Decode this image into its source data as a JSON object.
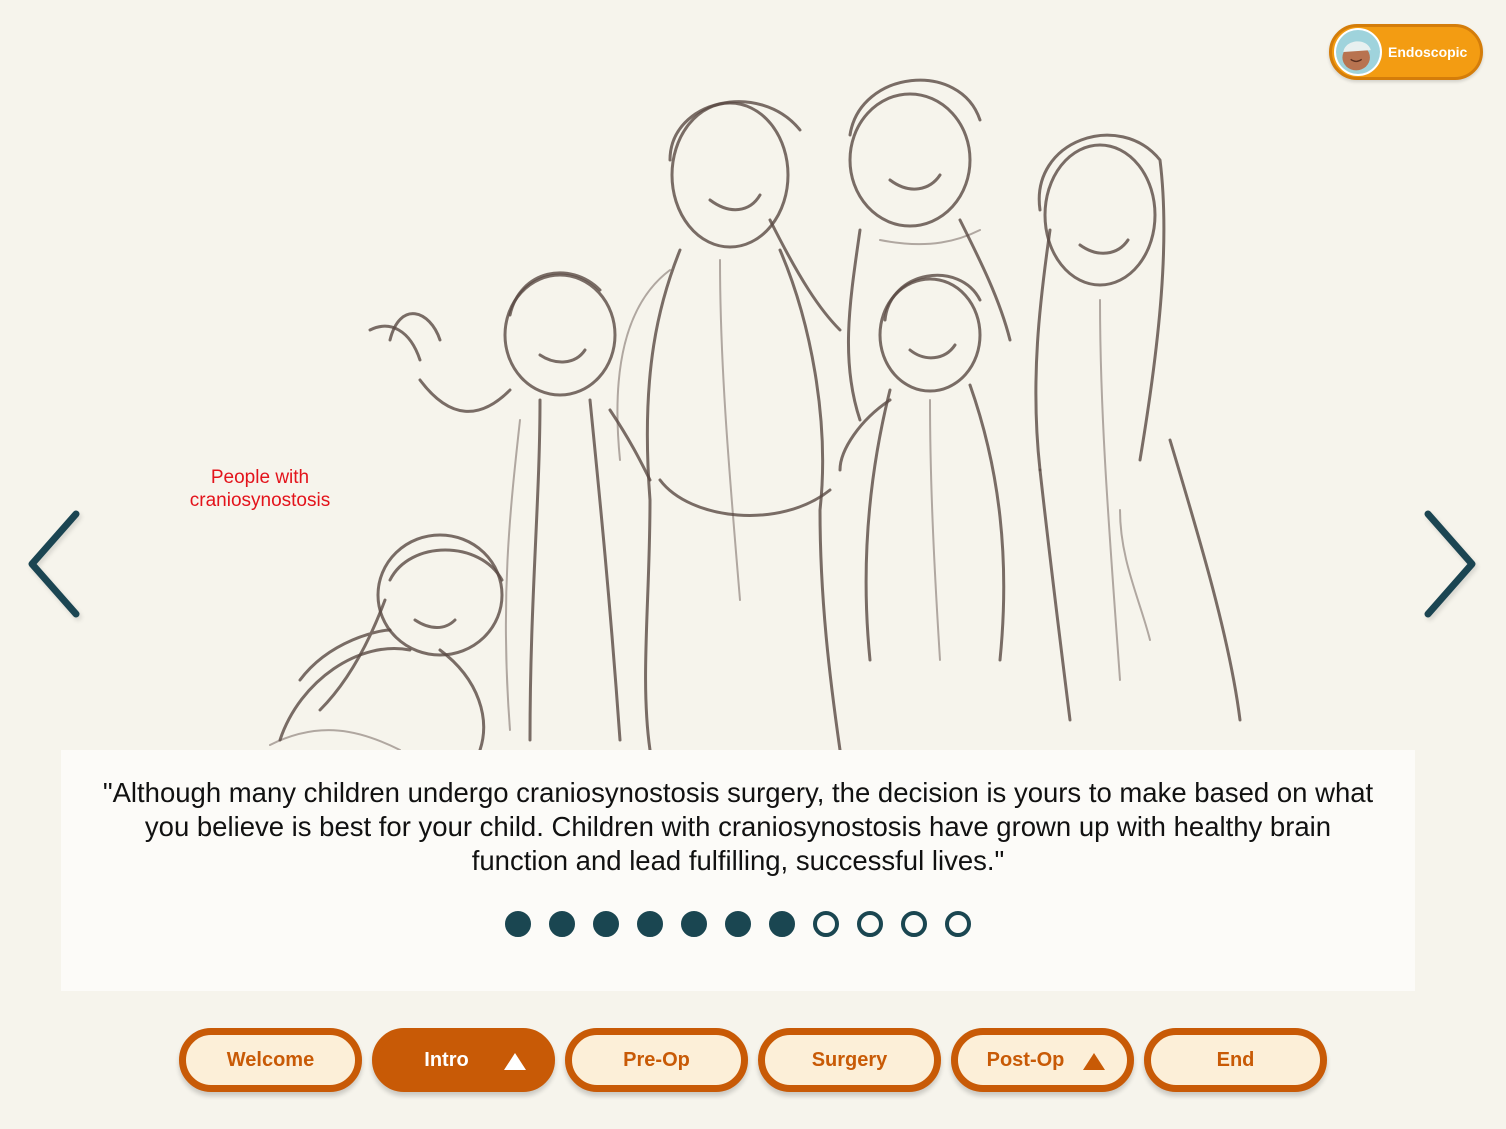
{
  "mode_badge": {
    "label": "Endoscopic",
    "icon": "child-avatar-icon"
  },
  "image_caption": "People with craniosynostosis",
  "quote": "\"Although many children undergo craniosynostosis surgery, the decision is yours to make based on what you believe is best for your child. Children with craniosynostosis have grown up with healthy brain function and lead fulfilling, successful lives.\"",
  "progress": {
    "total": 11,
    "completed": 7
  },
  "navigation": {
    "prev_icon": "chevron-left-icon",
    "next_icon": "chevron-right-icon"
  },
  "tabs": [
    {
      "label": "Welcome",
      "active": false,
      "expandable": false
    },
    {
      "label": "Intro",
      "active": true,
      "expandable": true
    },
    {
      "label": "Pre-Op",
      "active": false,
      "expandable": false
    },
    {
      "label": "Surgery",
      "active": false,
      "expandable": false
    },
    {
      "label": "Post-Op",
      "active": false,
      "expandable": true
    },
    {
      "label": "End",
      "active": false,
      "expandable": false
    }
  ],
  "colors": {
    "background": "#f6f4ec",
    "accent": "#c85a06",
    "badge": "#f39c12",
    "navy": "#1a4651",
    "caption": "#e3131b"
  }
}
